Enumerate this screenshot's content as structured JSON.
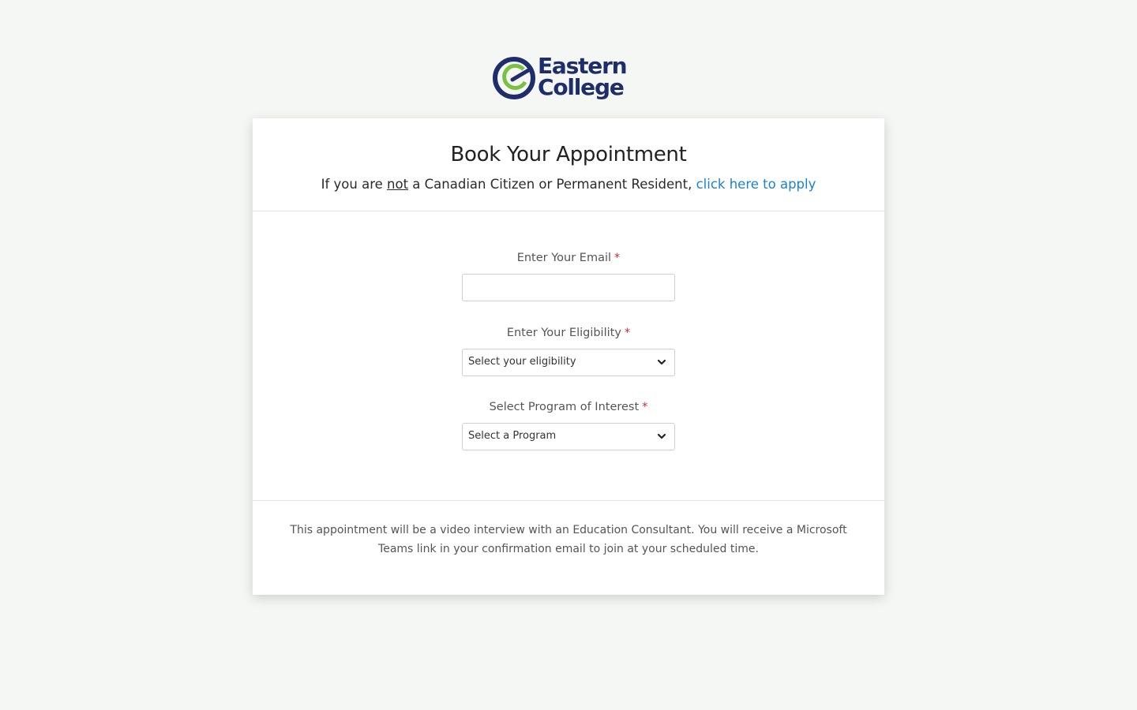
{
  "brand": {
    "line1": "Eastern",
    "line2": "College",
    "colors": {
      "navy": "#1f2e6b",
      "green": "#7ac143"
    }
  },
  "header": {
    "title": "Book Your Appointment",
    "subtitle_prefix": "If you are ",
    "subtitle_underlined": "not",
    "subtitle_suffix": " a Canadian Citizen or Permanent Resident, ",
    "apply_link": "click here to apply"
  },
  "form": {
    "email": {
      "label": "Enter Your Email",
      "required_mark": "*",
      "value": ""
    },
    "eligibility": {
      "label": "Enter Your Eligibility",
      "required_mark": "*",
      "selected": "Select your eligibility"
    },
    "program": {
      "label": "Select Program of Interest",
      "required_mark": "*",
      "selected": "Select a Program"
    }
  },
  "footer": {
    "note": "This appointment will be a video interview with an Education Consultant. You will receive a Microsoft Teams link in your confirmation email to join at your scheduled time."
  },
  "icons": {
    "logo": "eastern-college-logo-icon",
    "dropdown": "chevron-down-icon"
  }
}
